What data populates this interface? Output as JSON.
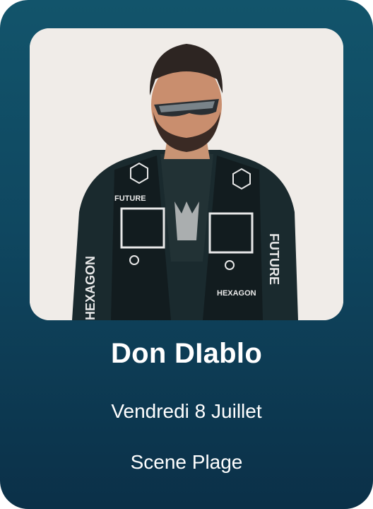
{
  "card": {
    "artist_name": "Don DIablo",
    "date": "Vendredi 8 Juillet",
    "stage": "Scene Plage"
  },
  "photo": {
    "future_left": "FUTURE",
    "hexagon_chest": "HEXAGON",
    "hexagon_sleeve": "HEXAGON",
    "future_sleeve": "FUTURE"
  }
}
